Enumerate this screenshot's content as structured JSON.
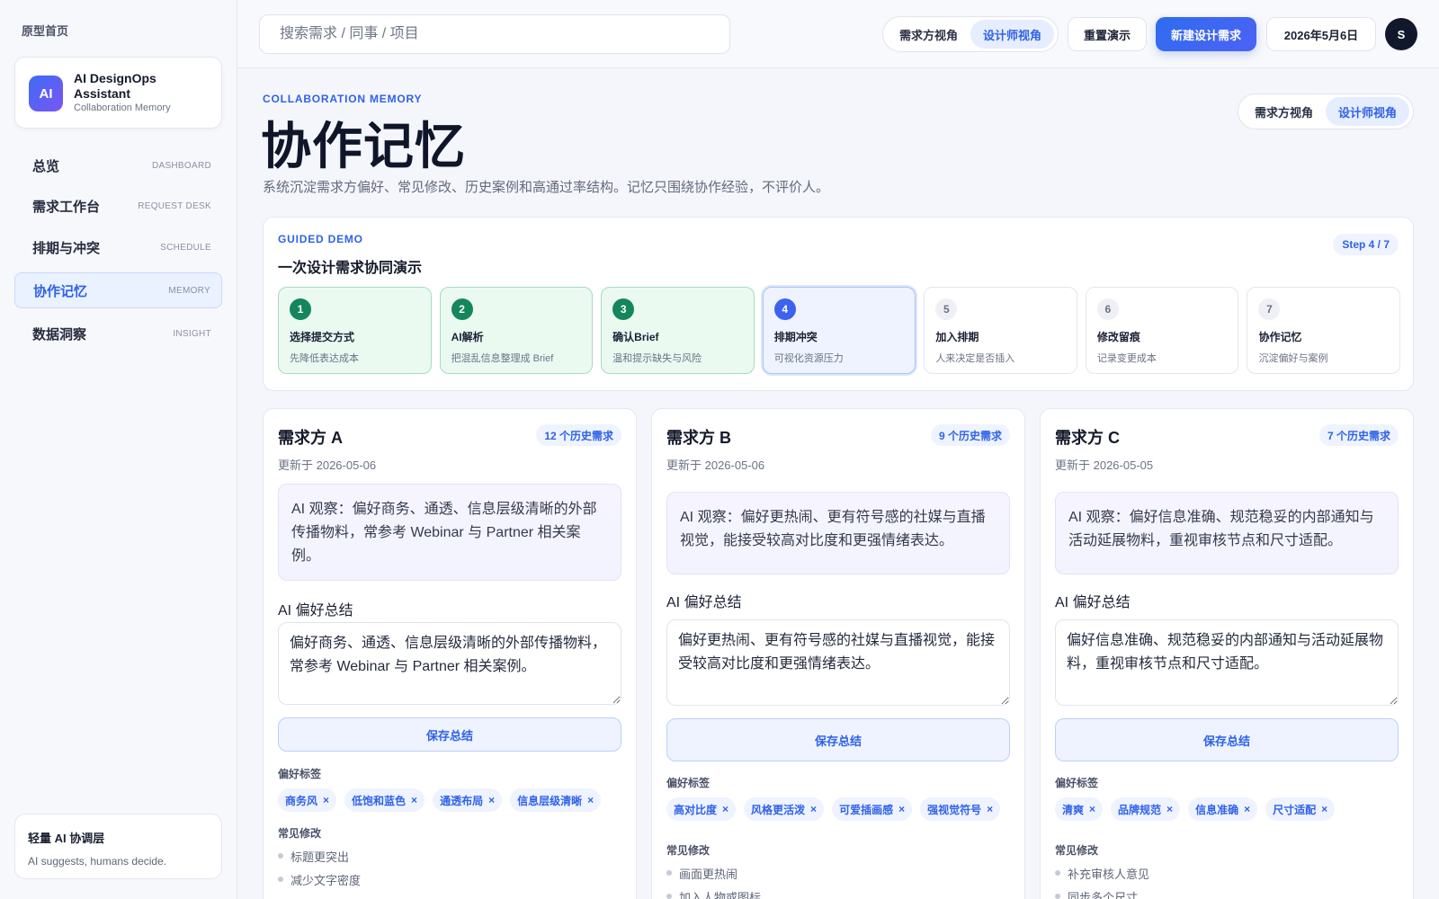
{
  "sidebar": {
    "home_link": "原型首页",
    "brand": {
      "logo": "AI",
      "name": "AI DesignOps Assistant",
      "subtitle": "Collaboration Memory"
    },
    "items": [
      {
        "label": "总览",
        "sub": "DASHBOARD"
      },
      {
        "label": "需求工作台",
        "sub": "REQUEST DESK"
      },
      {
        "label": "排期与冲突",
        "sub": "SCHEDULE"
      },
      {
        "label": "协作记忆",
        "sub": "MEMORY",
        "active": true
      },
      {
        "label": "数据洞察",
        "sub": "INSIGHT"
      }
    ],
    "footer": {
      "title": "轻量 AI 协调层",
      "text": "AI suggests, humans decide."
    }
  },
  "topbar": {
    "search_placeholder": "搜索需求 / 同事 / 项目",
    "view_toggle": {
      "requester": "需求方视角",
      "designer": "设计师视角",
      "selected": "designer"
    },
    "reset_label": "重置演示",
    "new_request_label": "新建设计需求",
    "date": "2026年5月6日",
    "avatar_initial": "S"
  },
  "header": {
    "eyebrow": "COLLABORATION MEMORY",
    "title": "协作记忆",
    "lead": "系统沉淀需求方偏好、常见修改、历史案例和高通过率结构。记忆只围绕协作经验，不评价人。",
    "view_toggle": {
      "requester": "需求方视角",
      "designer": "设计师视角",
      "selected": "designer"
    }
  },
  "demo": {
    "eyebrow": "GUIDED DEMO",
    "title": "一次设计需求协同演示",
    "step_count": "Step 4 / 7",
    "steps": [
      {
        "num": "1",
        "label": "选择提交方式",
        "desc": "先降低表达成本",
        "state": "done"
      },
      {
        "num": "2",
        "label": "AI解析",
        "desc": "把混乱信息整理成 Brief",
        "state": "done"
      },
      {
        "num": "3",
        "label": "确认Brief",
        "desc": "温和提示缺失与风险",
        "state": "done"
      },
      {
        "num": "4",
        "label": "排期冲突",
        "desc": "可视化资源压力",
        "state": "current"
      },
      {
        "num": "5",
        "label": "加入排期",
        "desc": "人来决定是否插入",
        "state": "todo"
      },
      {
        "num": "6",
        "label": "修改留痕",
        "desc": "记录变更成本",
        "state": "todo"
      },
      {
        "num": "7",
        "label": "协作记忆",
        "desc": "沉淀偏好与案例",
        "state": "todo"
      }
    ]
  },
  "clients": [
    {
      "name": "需求方 A",
      "history": "12 个历史需求",
      "updated": "更新于 2026-05-06",
      "observation": "AI 观察：偏好商务、通透、信息层级清晰的外部传播物料，常参考 Webinar 与 Partner 相关案例。",
      "summary_label": "AI 偏好总结",
      "summary": "偏好商务、通透、信息层级清晰的外部传播物料，常参考 Webinar 与 Partner 相关案例。",
      "save_label": "保存总结",
      "tags_label": "偏好标签",
      "tags": [
        "商务风",
        "低饱和蓝色",
        "通透布局",
        "信息层级清晰"
      ],
      "fixes_label": "常见修改",
      "fixes": [
        "标题更突出",
        "减少文字密度"
      ]
    },
    {
      "name": "需求方 B",
      "history": "9 个历史需求",
      "updated": "更新于 2026-05-06",
      "observation": "AI 观察：偏好更热闹、更有符号感的社媒与直播视觉，能接受较高对比度和更强情绪表达。",
      "summary_label": "AI 偏好总结",
      "summary": "偏好更热闹、更有符号感的社媒与直播视觉，能接受较高对比度和更强情绪表达。",
      "save_label": "保存总结",
      "tags_label": "偏好标签",
      "tags": [
        "高对比度",
        "风格更活泼",
        "可爱插画感",
        "强视觉符号"
      ],
      "fixes_label": "常见修改",
      "fixes": [
        "画面更热闹",
        "加入人物或图标"
      ]
    },
    {
      "name": "需求方 C",
      "history": "7 个历史需求",
      "updated": "更新于 2026-05-05",
      "observation": "AI 观察：偏好信息准确、规范稳妥的内部通知与活动延展物料，重视审核节点和尺寸适配。",
      "summary_label": "AI 偏好总结",
      "summary": "偏好信息准确、规范稳妥的内部通知与活动延展物料，重视审核节点和尺寸适配。",
      "save_label": "保存总结",
      "tags_label": "偏好标签",
      "tags": [
        "清爽",
        "品牌规范",
        "信息准确",
        "尺寸适配"
      ],
      "fixes_label": "常见修改",
      "fixes": [
        "补充审核人意见",
        "同步多个尺寸"
      ]
    }
  ],
  "colors": {
    "accent": "#2f62e8",
    "done": "#14865b",
    "current": "#3d62ee"
  }
}
